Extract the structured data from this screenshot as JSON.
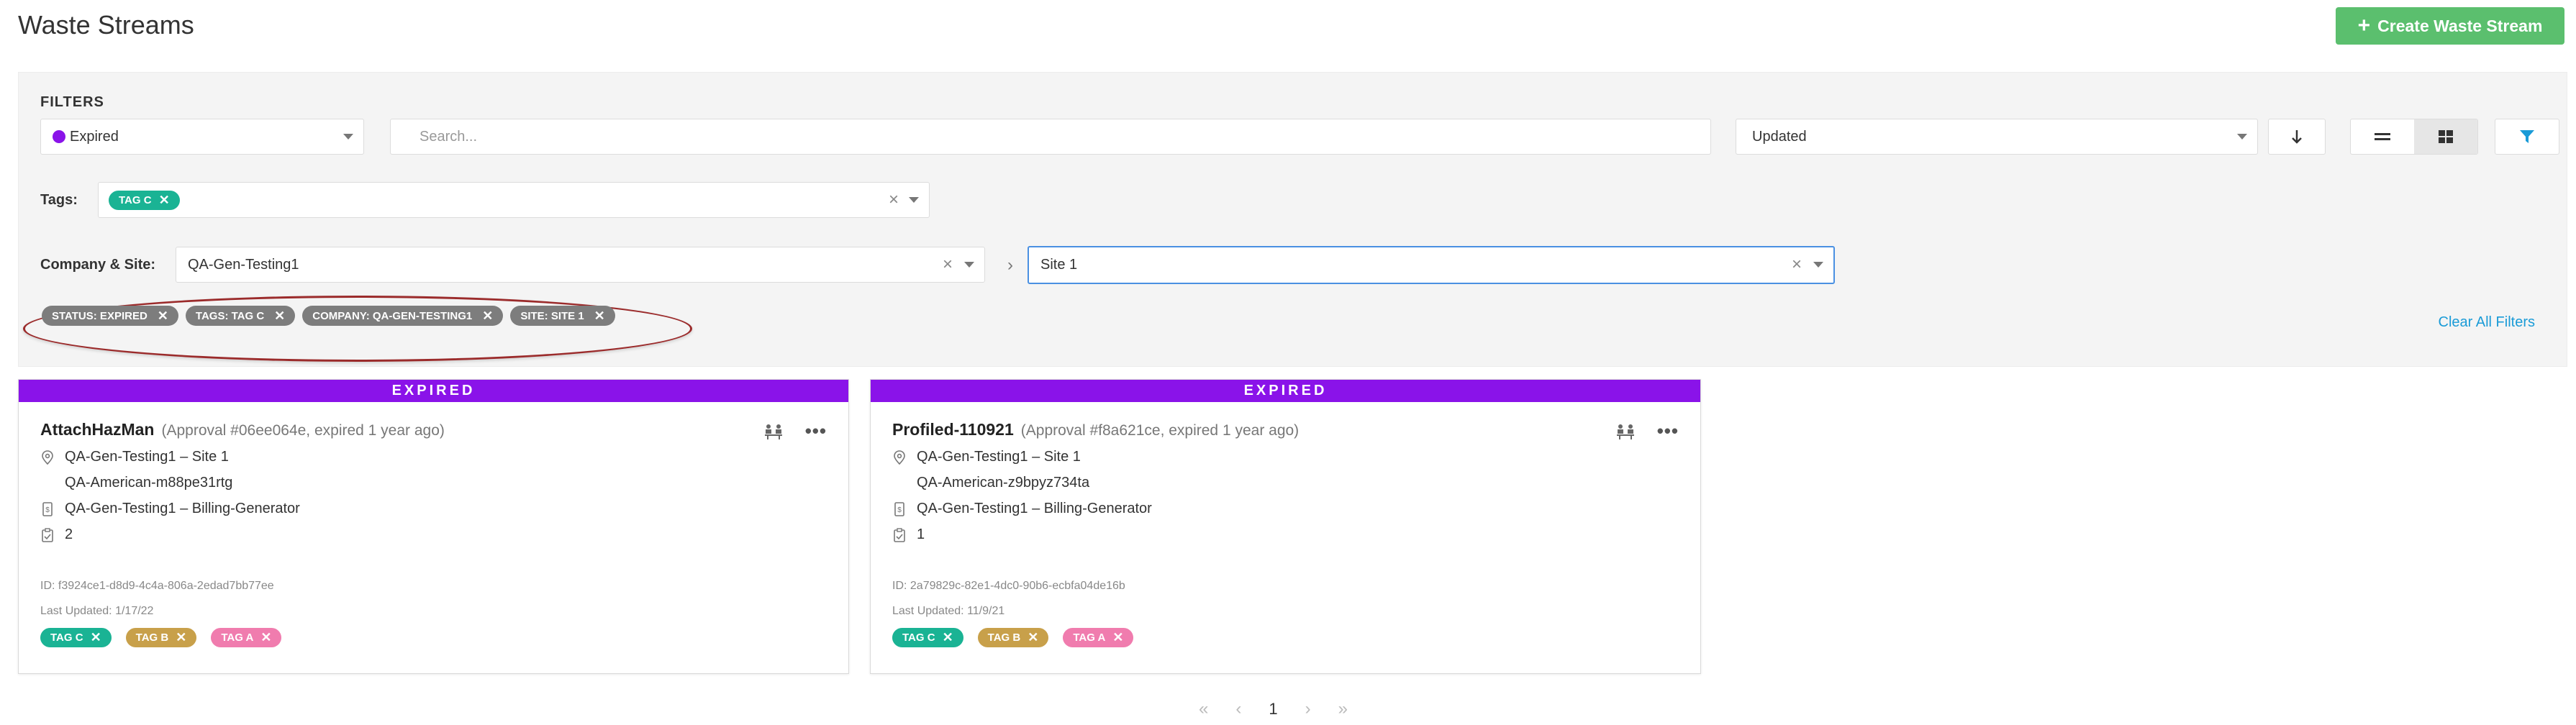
{
  "page": {
    "title": "Waste Streams",
    "create_button": "Create Waste Stream"
  },
  "filters": {
    "label": "FILTERS",
    "status_value": "Expired",
    "status_color": "#8a13e9",
    "search_placeholder": "Search...",
    "sort_value": "Updated",
    "tags_label": "Tags:",
    "selected_tag": "TAG C",
    "company_site_label": "Company & Site:",
    "company_value": "QA-Gen-Testing1",
    "site_value": "Site 1",
    "active": [
      "STATUS: EXPIRED",
      "TAGS: TAG C",
      "COMPANY: QA-GEN-TESTING1",
      "SITE: SITE 1"
    ],
    "clear_all": "Clear All Filters"
  },
  "cards": [
    {
      "banner": "EXPIRED",
      "name": "AttachHazMan",
      "subtitle": "(Approval #06ee064e, expired 1 year ago)",
      "location": "QA-Gen-Testing1 – Site 1",
      "vendor": "QA-American-m88pe31rtg",
      "billing": "QA-Gen-Testing1 – Billing-Generator",
      "count": "2",
      "id_line": "ID: f3924ce1-d8d9-4c4a-806a-2edad7bb77ee",
      "updated": "Last Updated: 1/17/22",
      "tags": [
        "TAG C",
        "TAG B",
        "TAG A"
      ]
    },
    {
      "banner": "EXPIRED",
      "name": "Profiled-110921",
      "subtitle": "(Approval #f8a621ce, expired 1 year ago)",
      "location": "QA-Gen-Testing1 – Site 1",
      "vendor": "QA-American-z9bpyz734ta",
      "billing": "QA-Gen-Testing1 – Billing-Generator",
      "count": "1",
      "id_line": "ID: 2a79829c-82e1-4dc0-90b6-ecbfa04de16b",
      "updated": "Last Updated: 11/9/21",
      "tags": [
        "TAG C",
        "TAG B",
        "TAG A"
      ]
    }
  ],
  "pagination": {
    "current": "1"
  },
  "colors": {
    "accent": "#5bbf6e",
    "expired": "#8a13e9",
    "tag_c": "#1ab394",
    "tag_b": "#c8a04a",
    "tag_a": "#f07cae",
    "link": "#1a9bd7"
  }
}
